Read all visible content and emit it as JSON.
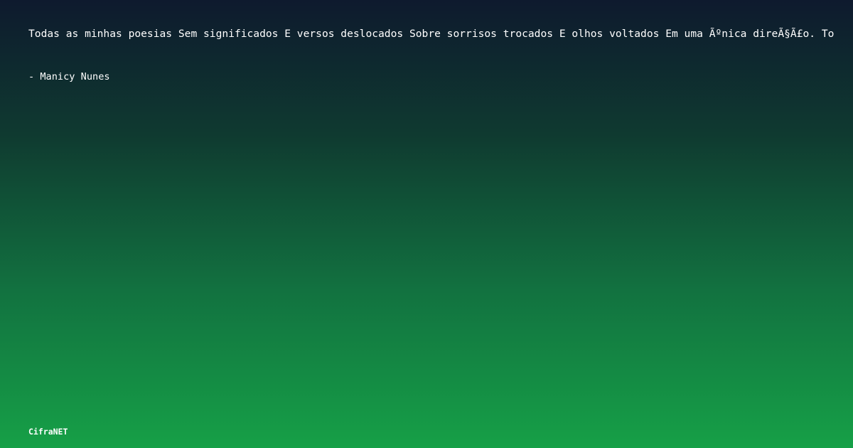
{
  "quote": {
    "text": "Todas as minhas poesias Sem significados E versos deslocados Sobre sorrisos trocados E olhos voltados Em uma Ãºnica direÃ§Ã£o. To",
    "author": "- Manicy Nunes"
  },
  "brand": {
    "name": "CifraNET"
  },
  "colors": {
    "background_top": "#0e1a2e",
    "background_bottom": "#16a047",
    "text": "#ffffff"
  }
}
